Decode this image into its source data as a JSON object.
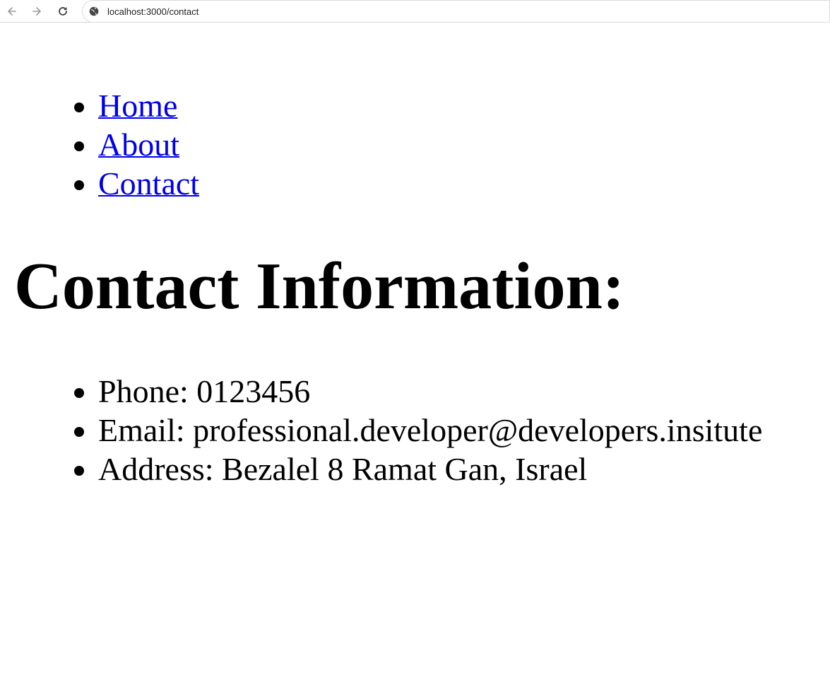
{
  "browser": {
    "url": "localhost:3000/contact",
    "back_icon": "arrow-left-icon",
    "forward_icon": "arrow-right-icon",
    "reload_icon": "reload-icon",
    "site_icon": "globe-icon"
  },
  "nav": {
    "items": [
      {
        "label": "Home"
      },
      {
        "label": "About"
      },
      {
        "label": "Contact"
      }
    ]
  },
  "main": {
    "title": "Contact Information:",
    "contact_items": [
      {
        "text": "Phone: 0123456"
      },
      {
        "text": "Email: professional.developer@developers.insitute"
      },
      {
        "text": "Address: Bezalel 8 Ramat Gan, Israel"
      }
    ]
  },
  "colors": {
    "link": "#0000ee",
    "text": "#000000",
    "background": "#ffffff"
  }
}
